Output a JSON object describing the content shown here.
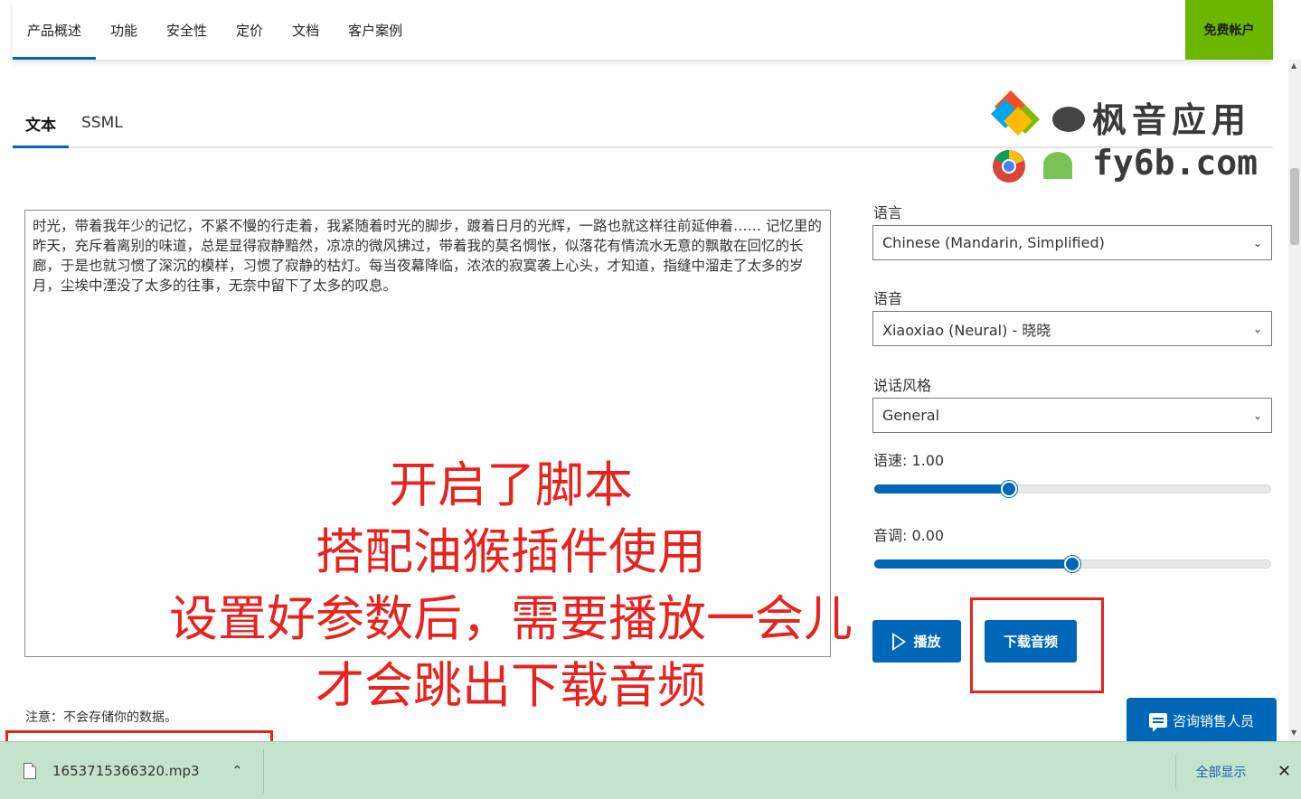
{
  "nav": {
    "items": [
      "产品概述",
      "功能",
      "安全性",
      "定价",
      "文档",
      "客户案例"
    ],
    "free_account": "免费帐户"
  },
  "tabs": [
    "文本",
    "SSML"
  ],
  "watermark": {
    "line1": "枫音应用",
    "line2": "fy6b.com"
  },
  "editor": {
    "text": "时光，带着我年少的记忆，不紧不慢的行走着，我紧随着时光的脚步，踱着日月的光辉，一路也就这样往前延伸着……    记忆里的昨天，充斥着离别的味道，总是显得寂静黯然，凉凉的微风拂过，带着我的莫名惆怅，似落花有情流水无意的飘散在回忆的长廊，于是也就习惯了深沉的模样，习惯了寂静的枯灯。每当夜幕降临，浓浓的寂寞袭上心头，才知道，指缝中溜走了太多的岁月，尘埃中湮没了太多的往事，无奈中留下了太多的叹息。"
  },
  "notice": "注意：不会存储你的数据。",
  "overlay": {
    "lines": [
      "开启了脚本",
      "搭配油猴插件使用",
      "设置好参数后，需要播放一会儿",
      "才会跳出下载音频"
    ],
    "color": "#e8231f"
  },
  "panel": {
    "language_label": "语言",
    "language_value": "Chinese (Mandarin, Simplified)",
    "voice_label": "语音",
    "voice_value": "Xiaoxiao (Neural) - 晓晓",
    "style_label": "说话风格",
    "style_value": "General",
    "rate_label": "语速: 1.00",
    "rate_fraction": 0.34,
    "pitch_label": "音调: 0.00",
    "pitch_fraction": 0.5,
    "play_label": "播放",
    "download_label": "下载音频"
  },
  "contact_sales": "咨询销售人员",
  "download_bar": {
    "file_name": "1653715366320.mp3",
    "show_all": "全部显示",
    "close": "✕"
  },
  "colors": {
    "accent": "#0067b8",
    "free_button": "#6bb700",
    "download_bar": "#c3e3cd"
  }
}
